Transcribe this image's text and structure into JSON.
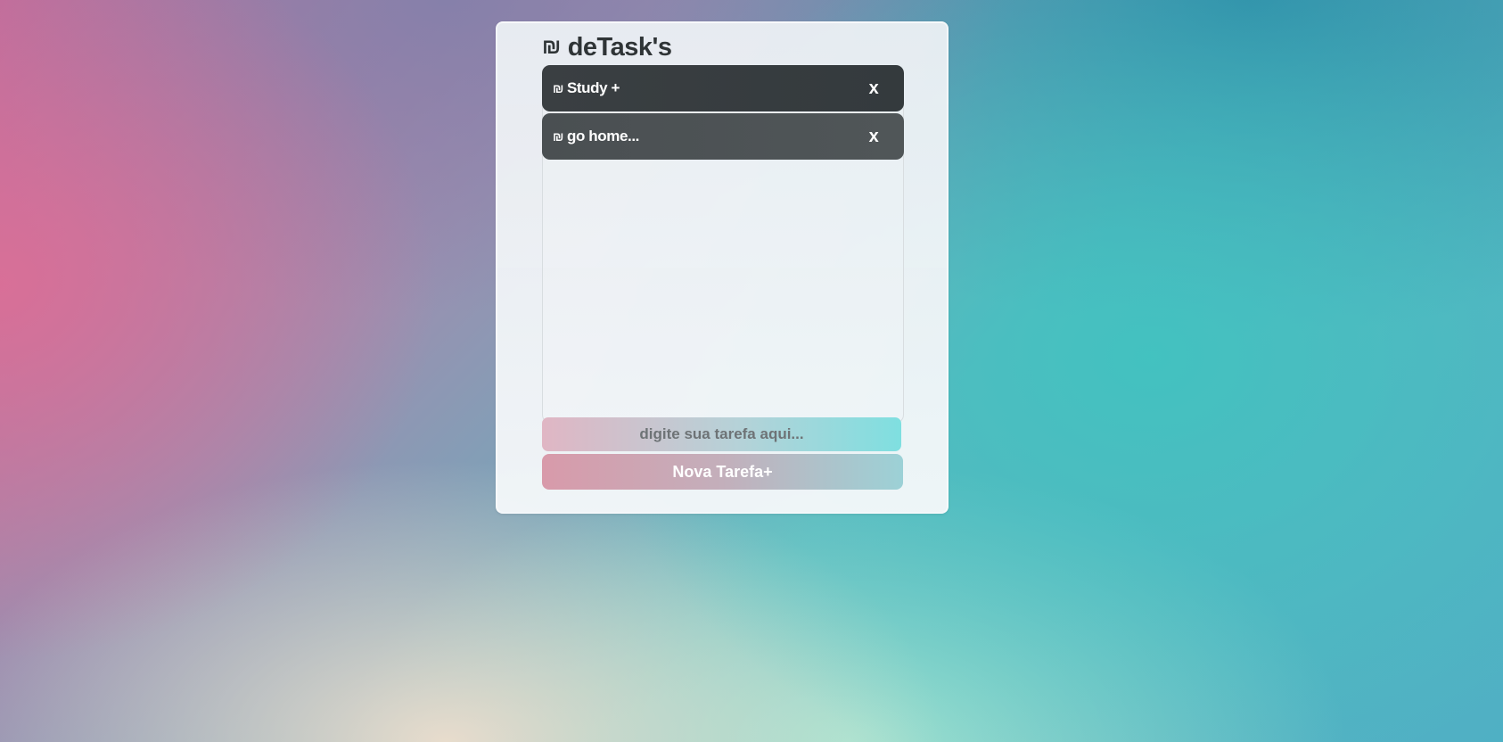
{
  "app": {
    "title": "deTask's",
    "logo_icon": "shekel-sign-icon",
    "logo_glyph": "₪"
  },
  "tasks": [
    {
      "glyph": "₪",
      "label": "Study +",
      "close_label": "x"
    },
    {
      "glyph": "₪",
      "label": "go home...",
      "close_label": "x"
    }
  ],
  "form": {
    "input_placeholder": "digite sua tarefa aqui...",
    "input_value": "",
    "add_button_label": "Nova Tarefa+"
  },
  "colors": {
    "task_dark": "#373c3f",
    "task_medium": "#4d5255",
    "title_text": "#2f3436",
    "accent_pink": "#d89aaa",
    "accent_teal": "#7fdfe0"
  }
}
